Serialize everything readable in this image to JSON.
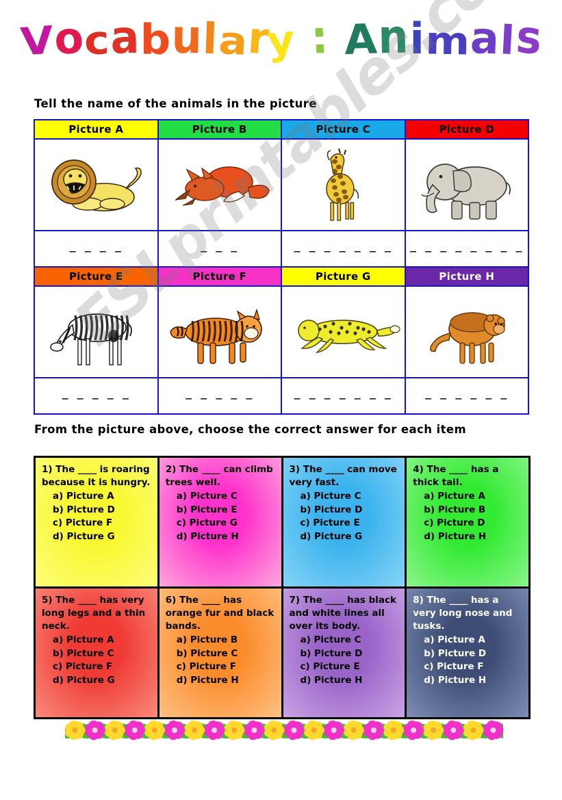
{
  "title": {
    "text": "Vocabulary : Animals",
    "letter_colors": [
      "#c2189e",
      "#e0194f",
      "#dd3024",
      "#e03327",
      "#ef4b1e",
      "#f06a1d",
      "#f4871c",
      "#f69d1b",
      "#f8b81a",
      "#fbe41c",
      "#8dc63f",
      "#1f7a5e",
      "#2a8a66",
      "#3b44b8",
      "#4a3fc0",
      "#6e3fc4",
      "#7d3fc6",
      "#8a3ec8",
      "#9a3dca",
      "#a83ccc"
    ]
  },
  "instructions": {
    "first": "Tell the name of the animals in the picture",
    "second": "From the picture above, choose the correct answer for each item"
  },
  "picture_table": {
    "rows": [
      {
        "cells": [
          {
            "header": "Picture A",
            "header_bg": "#ffff00",
            "header_text_tone": "light",
            "animal": "lion",
            "blank": "_ _ _ _"
          },
          {
            "header": "Picture B",
            "header_bg": "#22dd44",
            "header_text_tone": "light",
            "animal": "fox",
            "blank": "_ _ _"
          },
          {
            "header": "Picture C",
            "header_bg": "#19a8e8",
            "header_text_tone": "light",
            "animal": "giraffe",
            "blank": "_ _ _ _ _ _ _"
          },
          {
            "header": "Picture D",
            "header_bg": "#f40000",
            "header_text_tone": "light",
            "animal": "elephant",
            "blank": "_ _ _ _ _ _ _ _"
          }
        ]
      },
      {
        "cells": [
          {
            "header": "Picture E",
            "header_bg": "#f86400",
            "header_text_tone": "light",
            "animal": "zebra",
            "blank": "_ _ _ _ _"
          },
          {
            "header": "Picture F",
            "header_bg": "#f631c6",
            "header_text_tone": "light",
            "animal": "tiger",
            "blank": "_ _ _ _ _"
          },
          {
            "header": "Picture G",
            "header_bg": "#ffff00",
            "header_text_tone": "light",
            "animal": "cheetah",
            "blank": "_ _ _ _ _ _ _"
          },
          {
            "header": "Picture H",
            "header_bg": "#6a28a8",
            "header_text_tone": "dark",
            "animal": "monkey",
            "blank": "_ _ _ _ _ _"
          }
        ]
      }
    ]
  },
  "questions": [
    {
      "number": "1)",
      "stem": "1) The ____ is roaring because it is hungry.",
      "options": [
        "a) Picture A",
        "b) Picture D",
        "c) Picture F",
        "d) Picture G"
      ],
      "bg_from": "#fdfd7a",
      "bg_to": "#f8f832",
      "text_tone": "dark"
    },
    {
      "number": "2)",
      "stem": "2) The ____ can climb trees well.",
      "options": [
        "a) Picture C",
        "b) Picture E",
        "c) Picture G",
        "d) Picture H"
      ],
      "bg_from": "#ffa8de",
      "bg_to": "#ff33cc",
      "text_tone": "dark"
    },
    {
      "number": "3)",
      "stem": "3) The ____ can move very fast.",
      "options": [
        "a) Picture C",
        "b) Picture D",
        "c) Picture E",
        "d) Picture G"
      ],
      "bg_from": "#86d4f6",
      "bg_to": "#3cb3ee",
      "text_tone": "dark"
    },
    {
      "number": "4)",
      "stem": "4) The ____ has a thick tail.",
      "options": [
        "a) Picture A",
        "b) Picture B",
        "c) Picture D",
        "d) Picture H"
      ],
      "bg_from": "#8cf58c",
      "bg_to": "#31ea31",
      "text_tone": "dark"
    },
    {
      "number": "5)",
      "stem": "5) The ____ has very long legs and a thin neck.",
      "options": [
        "a) Picture A",
        "b) Picture C",
        "c) Picture F",
        "d) Picture G"
      ],
      "bg_from": "#fa8a7c",
      "bg_to": "#ef3b34",
      "text_tone": "dark"
    },
    {
      "number": "6)",
      "stem": "6) The ____ has orange fur and black bands.",
      "options": [
        "a) Picture B",
        "b) Picture C",
        "c) Picture F",
        "d) Picture H"
      ],
      "bg_from": "#ffc184",
      "bg_to": "#fb8c2c",
      "text_tone": "dark"
    },
    {
      "number": "7)",
      "stem": "7) The ____ has black and white lines all over its body.",
      "options": [
        "a) Picture C",
        "b) Picture D",
        "c) Picture E",
        "d) Picture H"
      ],
      "bg_from": "#c8a4e4",
      "bg_to": "#9a63c8",
      "text_tone": "dark"
    },
    {
      "number": "8)",
      "stem": "8) The ____ has a very long nose and tusks.",
      "options": [
        "a) Picture A",
        "b) Picture D",
        "c) Picture F",
        "d) Picture H"
      ],
      "bg_from": "#7d8fb4",
      "bg_to": "#3d4c74",
      "text_tone": "light"
    }
  ],
  "watermark": {
    "text": "ESLprintables.com"
  },
  "flower_border": {
    "flower_colors": [
      "#ffd92b",
      "#f030c8"
    ],
    "leaf_color": "#3fbf2f",
    "count": 22
  }
}
